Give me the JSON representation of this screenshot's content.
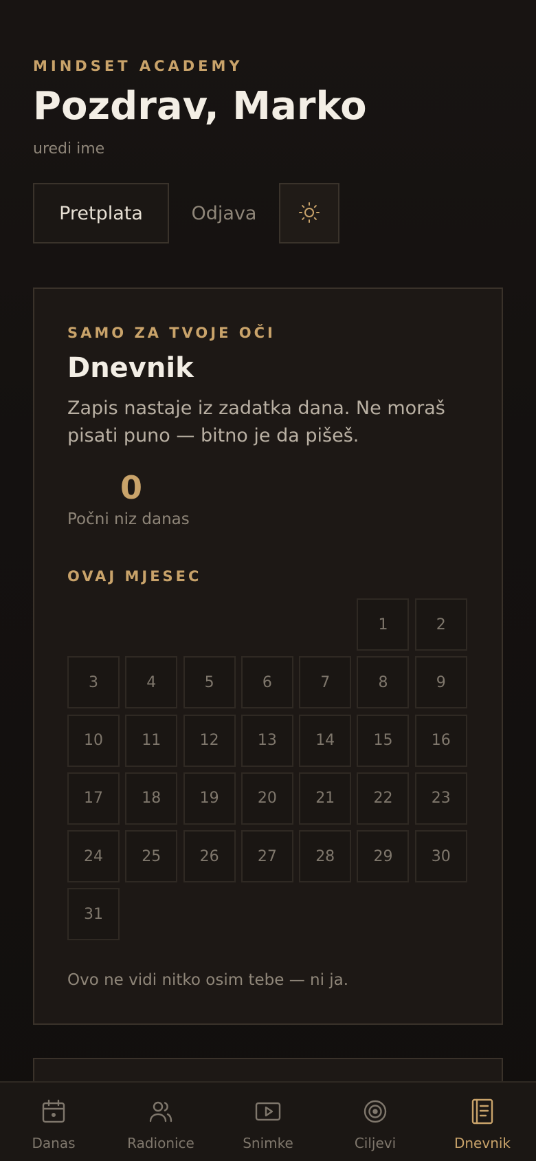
{
  "header": {
    "brand": "MINDSET ACADEMY",
    "greeting": "Pozdrav, Marko",
    "edit_name": "uredi ime",
    "subscription_label": "Pretplata",
    "logout_label": "Odjava",
    "theme_icon": "sun-icon"
  },
  "journal": {
    "kicker": "SAMO ZA TVOJE OČI",
    "title": "Dnevnik",
    "description": "Zapis nastaje iz zadatka dana. Ne moraš pisati puno — bitno je da pišeš.",
    "streak_count": "0",
    "streak_label": "Počni niz danas",
    "month_label": "OVAJ MJESEC",
    "calendar_leading_blanks": 5,
    "calendar_days": [
      "1",
      "2",
      "3",
      "4",
      "5",
      "6",
      "7",
      "8",
      "9",
      "10",
      "11",
      "12",
      "13",
      "14",
      "15",
      "16",
      "17",
      "18",
      "19",
      "20",
      "21",
      "22",
      "23",
      "24",
      "25",
      "26",
      "27",
      "28",
      "29",
      "30",
      "31"
    ],
    "footer": "Ovo ne vidi nitko osim tebe — ni ja."
  },
  "tabbar": {
    "tabs": [
      {
        "id": "danas",
        "label": "Danas",
        "icon": "calendar-icon",
        "active": false
      },
      {
        "id": "radionice",
        "label": "Radionice",
        "icon": "users-icon",
        "active": false
      },
      {
        "id": "snimke",
        "label": "Snimke",
        "icon": "play-icon",
        "active": false
      },
      {
        "id": "ciljevi",
        "label": "Ciljevi",
        "icon": "target-icon",
        "active": false
      },
      {
        "id": "dnevnik",
        "label": "Dnevnik",
        "icon": "notebook-icon",
        "active": true
      }
    ]
  },
  "colors": {
    "accent": "#c9a36a",
    "background": "#141110",
    "card": "#1d1815",
    "muted": "#8f8679"
  }
}
